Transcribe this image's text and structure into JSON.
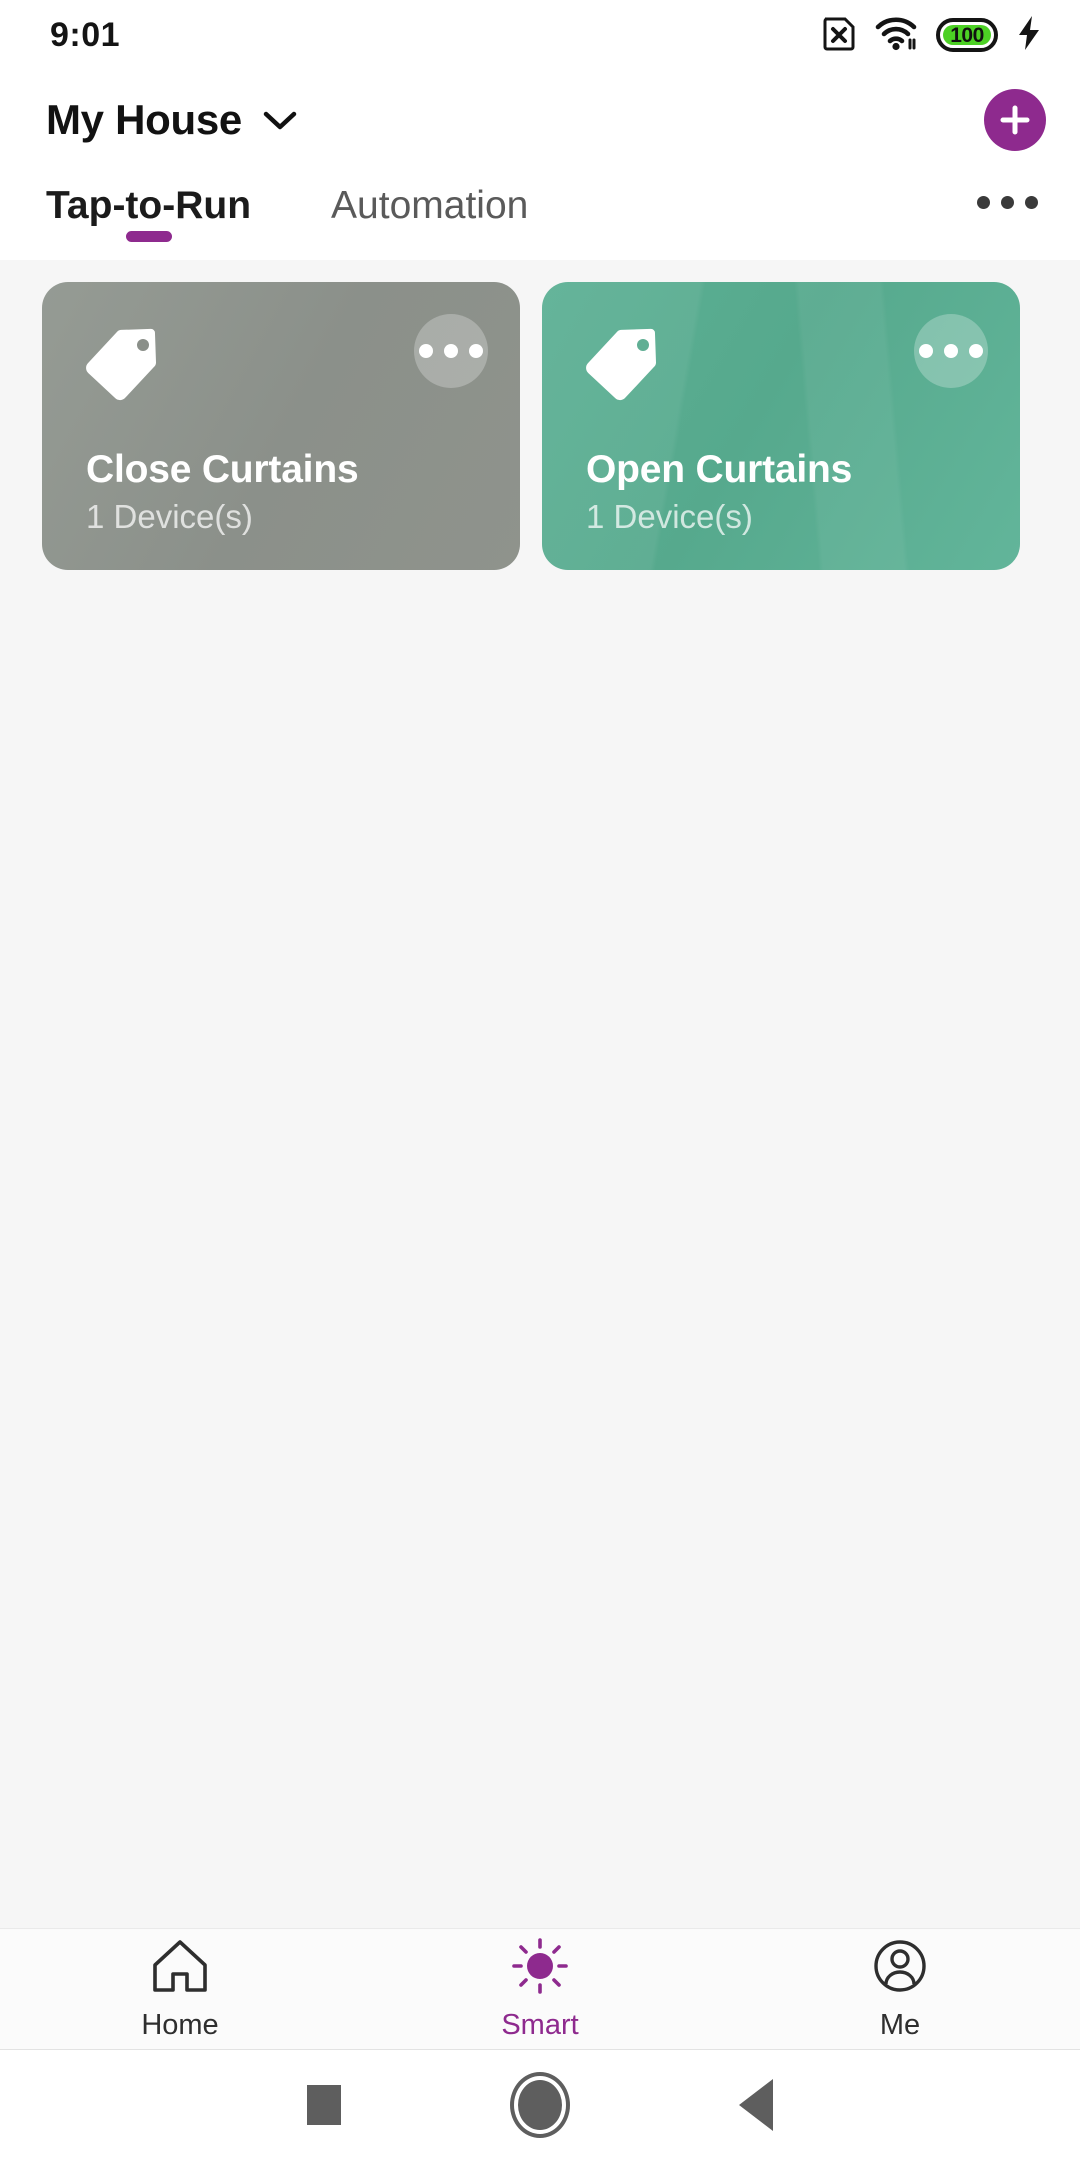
{
  "status_bar": {
    "time": "9:01",
    "battery_percent": "100",
    "icons": [
      "sim-no-card-icon",
      "wifi-icon",
      "battery-icon",
      "charging-bolt-icon"
    ]
  },
  "header": {
    "house_name": "My House",
    "chevron": "chevron-down-icon",
    "add_label": "+"
  },
  "tabs": {
    "items": [
      {
        "label": "Tap-to-Run",
        "active": true
      },
      {
        "label": "Automation",
        "active": false
      }
    ],
    "overflow": "more-options-icon"
  },
  "scenes": [
    {
      "title": "Close Curtains",
      "subtitle": "1 Device(s)",
      "icon": "tag-icon",
      "color": "#8B908A"
    },
    {
      "title": "Open Curtains",
      "subtitle": "1 Device(s)",
      "icon": "tag-icon",
      "color": "#56A98D"
    }
  ],
  "bottom_nav": {
    "items": [
      {
        "label": "Home",
        "icon": "home-icon",
        "active": false
      },
      {
        "label": "Smart",
        "icon": "smart-sun-icon",
        "active": true
      },
      {
        "label": "Me",
        "icon": "person-circle-icon",
        "active": false
      }
    ],
    "accent": "#8E2A8E"
  },
  "system_nav": {
    "recents": "square-recents-icon",
    "home": "circle-home-icon",
    "back": "triangle-back-icon"
  }
}
